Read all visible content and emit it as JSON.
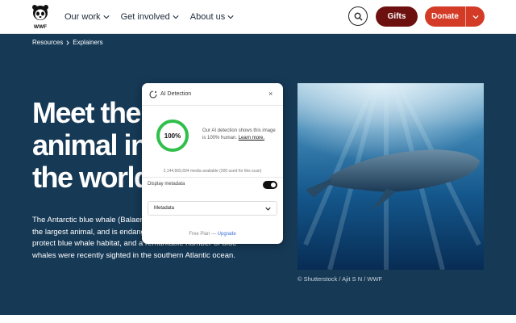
{
  "header": {
    "nav": [
      {
        "label": "Our work"
      },
      {
        "label": "Get involved"
      },
      {
        "label": "About us"
      }
    ],
    "gifts_label": "Gifts",
    "donate_label": "Donate",
    "icons": {
      "logo": "panda-logo-icon",
      "search": "search-icon",
      "chevron": "chevron-down-icon"
    }
  },
  "hero": {
    "breadcrumb": [
      "Resources",
      "Explainers"
    ],
    "title_lines": [
      "Meet the",
      "animal in",
      "the world"
    ],
    "body": "The Antarctic blue whale (Balaenoptera musculus Intermedia) is the largest animal, and is endangered. WWF is working to protect blue whale habitat, and a remarkable number of blue whales were recently sighted in the southern Atlantic ocean.",
    "caption": "© Shutterstock / Ajit S N / WWF"
  },
  "popup": {
    "title": "AI Detection",
    "close_glyph": "×",
    "score": 1.0,
    "score_label": "100%",
    "result_text": "Our AI detection shows this image is 100% human.",
    "learn_more": "Learn more.",
    "media_note": "2,144,665,694 media available (300 used for this scan)",
    "display_label": "Display metadata",
    "toggle_on": true,
    "select_value": "Metadata",
    "plan_text": "Free Plan — ",
    "upgrade_label": "Upgrade",
    "colors": {
      "ring": "#2fbf4a",
      "toggle": "#111111",
      "upgrade": "#3a6fd8"
    }
  },
  "colors": {
    "hero_bg": "#163956",
    "gifts": "#6d1010",
    "donate": "#d33b26"
  }
}
